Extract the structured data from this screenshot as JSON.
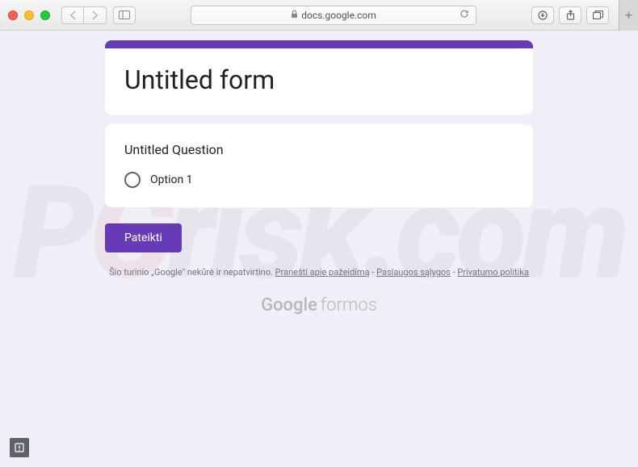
{
  "browser": {
    "url_host": "docs.google.com"
  },
  "form": {
    "title": "Untitled form",
    "question": {
      "title": "Untitled Question",
      "options": [
        "Option 1"
      ]
    },
    "submit_label": "Pateikti"
  },
  "disclaimer": {
    "prefix": "Šio turinio „Google\" nekūrė ir nepatvirtino. ",
    "report_label": "Pranešti apie pažeidimą",
    "sep": " - ",
    "terms_label": "Paslaugos sąlygos",
    "privacy_label": "Privatumo politika"
  },
  "branding": {
    "google": "Google",
    "forms": "formos"
  },
  "watermark": {
    "p": "P",
    "c": "C",
    "rest": "risk.com"
  }
}
